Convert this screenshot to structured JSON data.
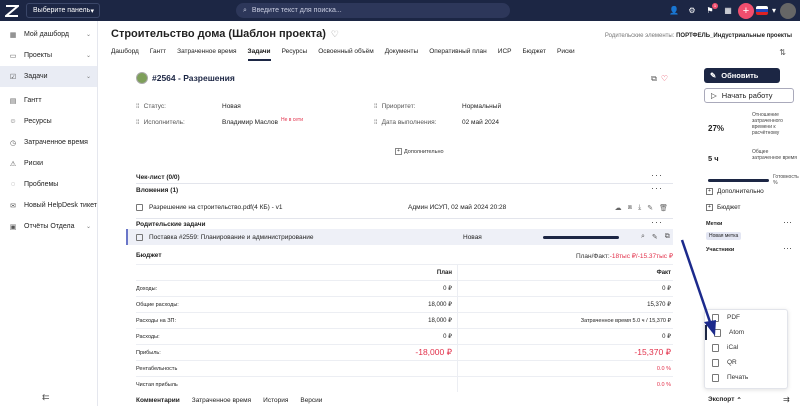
{
  "topbar": {
    "panel_select": "Выберите панель",
    "search_placeholder": "Введите текст для поиска...",
    "notification_count": "1"
  },
  "sidebar": {
    "items": [
      {
        "label": "Мой дашборд",
        "icon": "grid-icon"
      },
      {
        "label": "Проекты",
        "icon": "folder-icon"
      },
      {
        "label": "Задачи",
        "icon": "tasks-icon"
      },
      {
        "label": "Гантт",
        "icon": "gantt-icon"
      },
      {
        "label": "Ресурсы",
        "icon": "people-icon"
      },
      {
        "label": "Затраченное время",
        "icon": "clock-icon"
      },
      {
        "label": "Риски",
        "icon": "warning-icon"
      },
      {
        "label": "Проблемы",
        "icon": "problem-icon"
      },
      {
        "label": "Новый HelpDesk тикет",
        "icon": "ticket-icon"
      },
      {
        "label": "Отчёты Отдела",
        "icon": "report-icon"
      }
    ]
  },
  "page": {
    "title": "Строительство дома (Шаблон проекта)",
    "parents_label": "Родительские элементы:",
    "parents_value": "ПОРТФЕЛЬ_Индустриальные проекты",
    "tabs": [
      "Дашборд",
      "Гантт",
      "Затраченное время",
      "Задачи",
      "Ресурсы",
      "Освоенный объём",
      "Документы",
      "Оперативный план",
      "ИСР",
      "Бюджет",
      "Риски"
    ]
  },
  "task": {
    "title": "#2564 - Разрешения",
    "status_label": "Статус:",
    "status_value": "Новая",
    "priority_label": "Приоритет:",
    "priority_value": "Нормальный",
    "assignee_label": "Исполнитель:",
    "assignee_value": "Владимир Маслов",
    "offline": "Не в сети",
    "due_label": "Дата выполнения:",
    "due_value": "02 май 2024",
    "more_label": "Дополнительно"
  },
  "checklist": {
    "title": "Чек-лист (0/0)"
  },
  "attachments": {
    "title": "Вложения (1)",
    "file": "Разрешение на строительство.pdf(4 КБ) - v1",
    "meta": "Админ ИСУП, 02 май 2024 20:28"
  },
  "parent_tasks": {
    "title": "Родительские задачи",
    "row_name": "Поставка #2559: Планирование и администрирование",
    "row_status": "Новая"
  },
  "budget": {
    "title": "Бюджет",
    "planfact_label": "План/Факт:",
    "planfact_value": "-18тыс ₽/-15.37тыс ₽",
    "col_plan": "План",
    "col_fact": "Факт",
    "rows": [
      {
        "label": "Доходы:",
        "plan": "0 ₽",
        "fact": "0 ₽"
      },
      {
        "label": "Общие расходы:",
        "plan": "18,000 ₽",
        "fact": "15,370 ₽"
      },
      {
        "label": "Расходы на ЗП:",
        "plan": "18,000 ₽",
        "fact": "Затраченное время 5.0 ч / 15,370 ₽"
      },
      {
        "label": "Расходы:",
        "plan": "0 ₽",
        "fact": "0 ₽"
      },
      {
        "label": "Прибыль:",
        "plan": "-18,000 ₽",
        "fact": "-15,370 ₽"
      },
      {
        "label": "Рентабельность",
        "plan": "",
        "fact": "0.0 %"
      },
      {
        "label": "Чистая прибыль",
        "plan": "",
        "fact": "0.0 %"
      }
    ]
  },
  "bottom_tabs": [
    "Комментарии",
    "Затраченное время",
    "История",
    "Версии"
  ],
  "right_panel": {
    "update_btn": "Обновить",
    "start_btn": "Начать работу",
    "percent": "27%",
    "percent_label": "Отношение затраченного времени к расчётному",
    "hours": "5 ч",
    "hours_label": "Общее затраченное время",
    "ready_label": "Готовность %",
    "ready_fraction": 1.0,
    "more_label": "Дополнительно",
    "budget_label": "Бюджет",
    "tags_label": "Метки",
    "tag": "Новая метка",
    "participants_label": "Участники",
    "export_label": "Экспорт"
  },
  "export_menu": [
    "PDF",
    "Atom",
    "iCal",
    "QR",
    "Печать"
  ],
  "colors": {
    "navy": "#1c2644",
    "red": "#e2304a",
    "accent_pink": "#f04e6e"
  }
}
